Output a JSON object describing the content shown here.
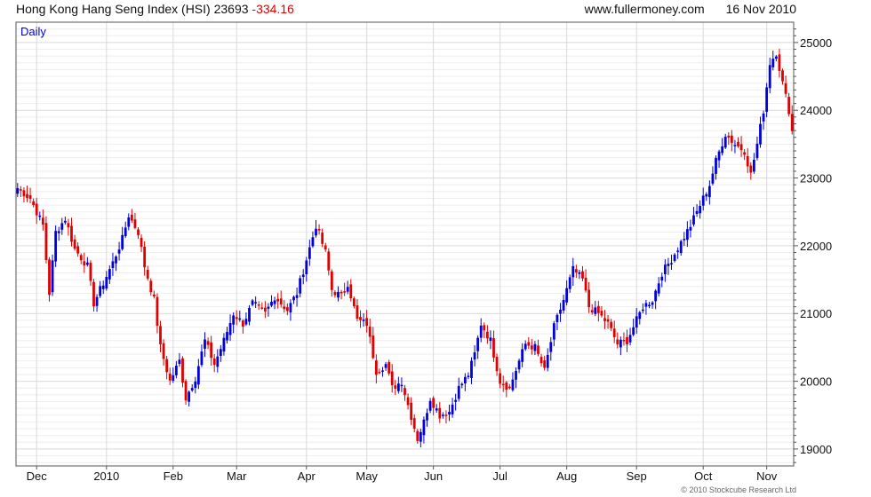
{
  "header": {
    "index_name": "Hong Kong Hang Seng Index (HSI)",
    "last": "23693",
    "change": "-334.16",
    "website": "www.fullermoney.com",
    "date": "16 Nov 2010"
  },
  "footer": {
    "copyright": "© 2010 Stockcube Research Ltd"
  },
  "colors": {
    "up": "#0000dd",
    "down": "#e00000",
    "grid": "#d9d9d9",
    "minor_grid": "#eeeeee",
    "frame": "#555555"
  },
  "chart_data": {
    "type": "candlestick",
    "period_label": "Daily",
    "title": "Hong Kong Hang Seng Index (HSI)",
    "ylim": [
      18750,
      25300
    ],
    "y_ticks": [
      19000,
      20000,
      21000,
      22000,
      23000,
      24000,
      25000
    ],
    "y_tick_labels": [
      "19000",
      "20000",
      "21000",
      "22000",
      "23000",
      "24000",
      "25000"
    ],
    "x_ticks": [
      {
        "label": "Dec",
        "day": 6
      },
      {
        "label": "2010",
        "day": 28
      },
      {
        "label": "Feb",
        "day": 49
      },
      {
        "label": "Mar",
        "day": 69
      },
      {
        "label": "Apr",
        "day": 91
      },
      {
        "label": "May",
        "day": 110
      },
      {
        "label": "Jun",
        "day": 131
      },
      {
        "label": "Jul",
        "day": 152
      },
      {
        "label": "Aug",
        "day": 173
      },
      {
        "label": "Sep",
        "day": 195
      },
      {
        "label": "Oct",
        "day": 216
      },
      {
        "label": "Nov",
        "day": 236
      }
    ],
    "y_axis_position": "right",
    "grid": true,
    "close_path": [
      [
        0,
        22850
      ],
      [
        4,
        22700
      ],
      [
        8,
        22300
      ],
      [
        10,
        21300
      ],
      [
        12,
        22200
      ],
      [
        15,
        22400
      ],
      [
        18,
        21950
      ],
      [
        22,
        21700
      ],
      [
        24,
        21150
      ],
      [
        27,
        21450
      ],
      [
        30,
        21750
      ],
      [
        33,
        22100
      ],
      [
        35,
        22450
      ],
      [
        38,
        22200
      ],
      [
        40,
        21700
      ],
      [
        43,
        21200
      ],
      [
        45,
        20500
      ],
      [
        48,
        20000
      ],
      [
        51,
        20300
      ],
      [
        53,
        19750
      ],
      [
        56,
        20050
      ],
      [
        59,
        20600
      ],
      [
        62,
        20250
      ],
      [
        65,
        20600
      ],
      [
        68,
        21000
      ],
      [
        71,
        20850
      ],
      [
        74,
        21150
      ],
      [
        78,
        21000
      ],
      [
        81,
        21250
      ],
      [
        85,
        21050
      ],
      [
        88,
        21300
      ],
      [
        91,
        21800
      ],
      [
        94,
        22300
      ],
      [
        97,
        21900
      ],
      [
        99,
        21350
      ],
      [
        102,
        21250
      ],
      [
        104,
        21450
      ],
      [
        107,
        20900
      ],
      [
        110,
        20850
      ],
      [
        113,
        20150
      ],
      [
        116,
        20250
      ],
      [
        118,
        19900
      ],
      [
        121,
        20000
      ],
      [
        123,
        19650
      ],
      [
        126,
        19150
      ],
      [
        128,
        19400
      ],
      [
        130,
        19750
      ],
      [
        133,
        19500
      ],
      [
        136,
        19550
      ],
      [
        139,
        19900
      ],
      [
        142,
        20100
      ],
      [
        144,
        20400
      ],
      [
        146,
        20850
      ],
      [
        149,
        20600
      ],
      [
        152,
        20000
      ],
      [
        155,
        19900
      ],
      [
        158,
        20300
      ],
      [
        160,
        20550
      ],
      [
        163,
        20500
      ],
      [
        166,
        20150
      ],
      [
        169,
        20800
      ],
      [
        172,
        21200
      ],
      [
        175,
        21650
      ],
      [
        178,
        21500
      ],
      [
        180,
        21100
      ],
      [
        183,
        21000
      ],
      [
        186,
        20850
      ],
      [
        189,
        20550
      ],
      [
        192,
        20600
      ],
      [
        194,
        20800
      ],
      [
        197,
        21100
      ],
      [
        200,
        21200
      ],
      [
        203,
        21600
      ],
      [
        206,
        21800
      ],
      [
        209,
        22050
      ],
      [
        212,
        22300
      ],
      [
        215,
        22600
      ],
      [
        218,
        22900
      ],
      [
        220,
        23250
      ],
      [
        223,
        23650
      ],
      [
        226,
        23500
      ],
      [
        229,
        23400
      ],
      [
        231,
        23050
      ],
      [
        233,
        23500
      ],
      [
        235,
        24000
      ],
      [
        237,
        24700
      ],
      [
        239,
        24850
      ],
      [
        241,
        24400
      ],
      [
        243,
        24000
      ],
      [
        244,
        23693
      ]
    ]
  }
}
